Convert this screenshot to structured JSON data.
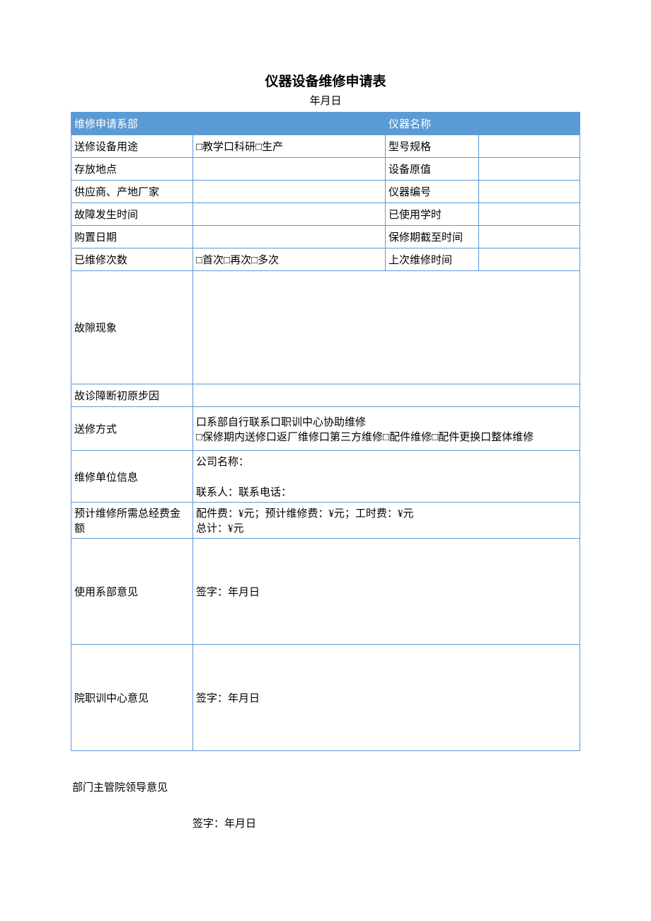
{
  "title": "仪器设备维修申请表",
  "date_line": "年月日",
  "header": {
    "c1": "维修申请系部",
    "c2": "",
    "c3": "仪器名称",
    "c4": ""
  },
  "rows": {
    "usage_label": "送修设备用途",
    "usage_val": "□教学口科研□生产",
    "model_label": "型号规格",
    "model_val": "",
    "location_label": "存放地点",
    "location_val": "",
    "origvalue_label": "设备原值",
    "origvalue_val": "",
    "supplier_label": "供应商、产地厂家",
    "supplier_val": "",
    "equipno_label": "仪器编号",
    "equipno_val": "",
    "faulttime_label": "故障发生时间",
    "faulttime_val": "",
    "usedhours_label": "已使用学时",
    "usedhours_val": "",
    "purchase_label": "购置日期",
    "purchase_val": "",
    "warranty_label": "保修期截至时间",
    "warranty_val": "",
    "repaircount_label": "已维修次数",
    "repaircount_val": "□首次□再次□多次",
    "lastrepair_label": "上次维修时间",
    "lastrepair_val": "",
    "symptom_label": "故隙现象",
    "symptom_val": "",
    "diag_label": "故诊障断初原步因",
    "diag_val": "",
    "method_label": "送修方式",
    "method_line1": "口系部自行联系口职训中心协助维修",
    "method_line2": "□保修期内送修口返厂维修口第三方维修□配件维修□配件更换口整体维修",
    "unit_label": "维修单位信息",
    "unit_line1": "公司名称：",
    "unit_line2": "联系人：联系电话：",
    "cost_label": "预计维修所需总经费金额",
    "cost_line1": "配件费：¥元；预计维修费：¥元；工时费：¥元",
    "cost_line2": "总计：¥元",
    "deptopinion_label": "使用系部意见",
    "deptopinion_sign": "签字：年月日",
    "center_label": "院职训中心意见",
    "center_sign": "签字：年月日"
  },
  "below": {
    "leader_label": "部门主管院领导意见",
    "leader_sign": "签字：年月日"
  }
}
